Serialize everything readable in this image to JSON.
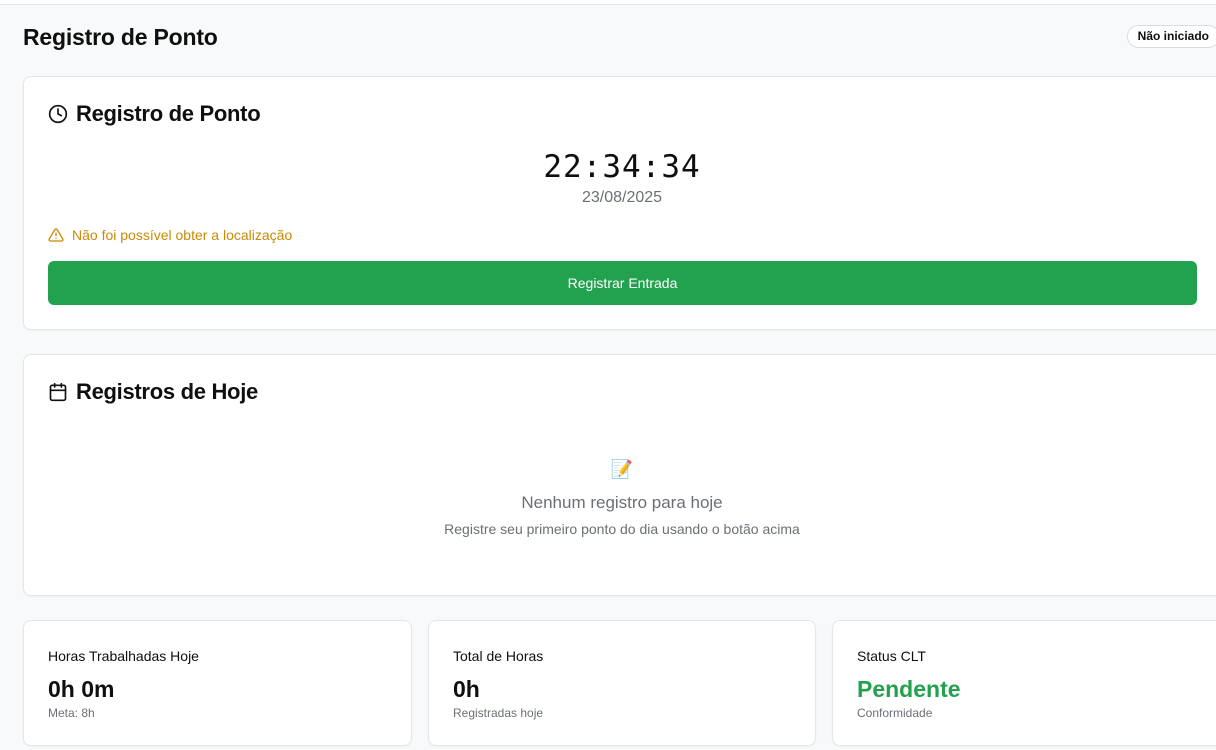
{
  "header": {
    "title": "Registro de Ponto",
    "status_badge": "Não iniciado"
  },
  "clock_card": {
    "title": "Registro de Ponto",
    "time": "22:34:34",
    "date": "23/08/2025",
    "warning": "Não foi possível obter a localização",
    "button_label": "Registrar Entrada",
    "accent_color": "#22a14e",
    "warning_color": "#ca8a04"
  },
  "today_card": {
    "title": "Registros de Hoje",
    "empty_icon": "📝",
    "empty_title": "Nenhum registro para hoje",
    "empty_subtitle": "Registre seu primeiro ponto do dia usando o botão acima"
  },
  "stats": [
    {
      "label": "Horas Trabalhadas Hoje",
      "value": "0h 0m",
      "sub": "Meta: 8h"
    },
    {
      "label": "Total de Horas",
      "value": "0h",
      "sub": "Registradas hoje"
    },
    {
      "label": "Status CLT",
      "value": "Pendente",
      "sub": "Conformidade"
    }
  ],
  "icons": {
    "clock_card": "clock-icon",
    "warning": "warning-triangle-icon",
    "today_card": "calendar-icon"
  }
}
